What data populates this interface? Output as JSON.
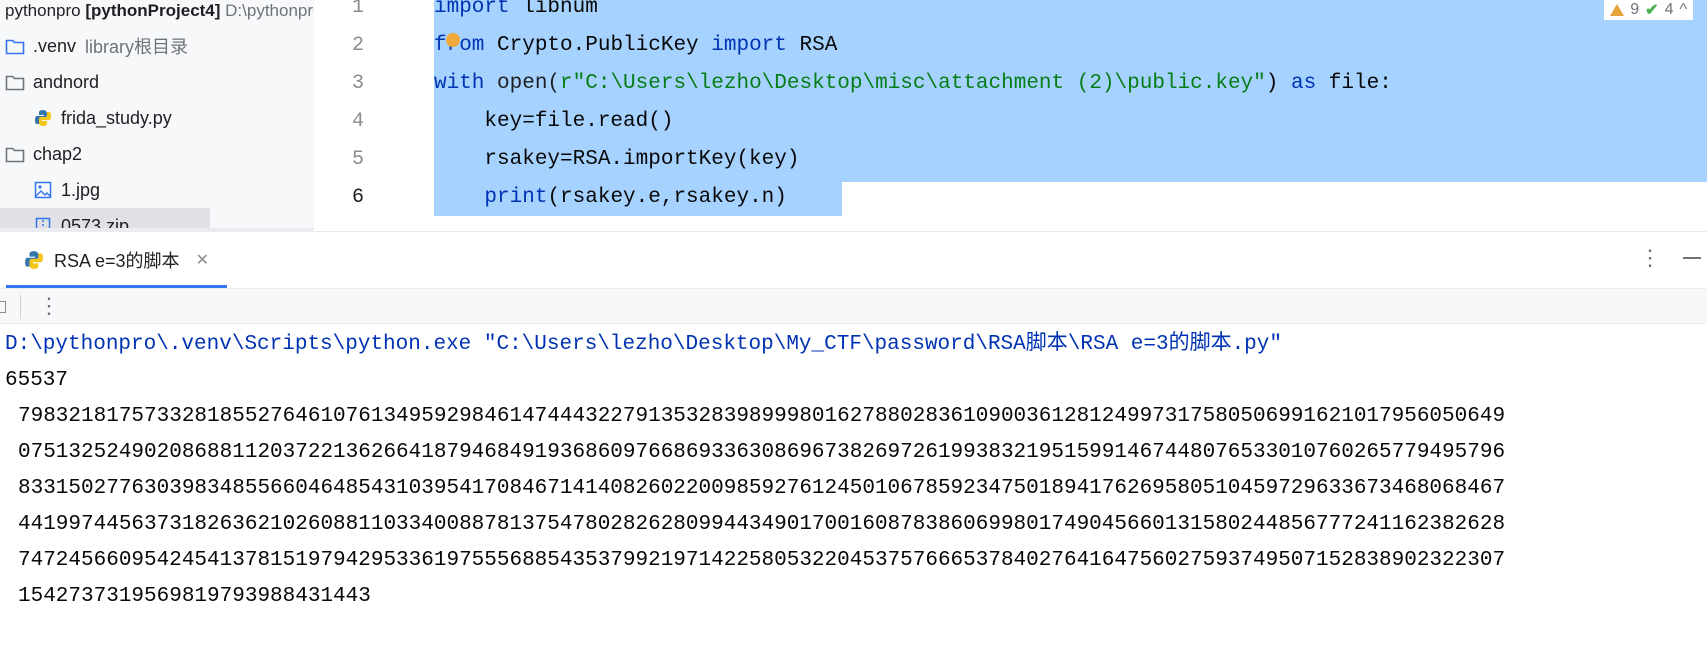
{
  "project": {
    "root": {
      "name": "pythonpro",
      "project": "[pythonProject4]",
      "path": "D:\\pythonpro"
    },
    "items": [
      {
        "label": ".venv",
        "hint": "library根目录",
        "icon": "folder-icon"
      },
      {
        "label": "andnord",
        "icon": "folder-icon"
      },
      {
        "label": "frida_study.py",
        "icon": "python-file-icon"
      },
      {
        "label": "chap2",
        "icon": "folder-icon"
      },
      {
        "label": "1.jpg",
        "icon": "image-file-icon"
      },
      {
        "label": "0573.zip",
        "icon": "zip-file-icon"
      }
    ]
  },
  "editor": {
    "line_numbers": [
      "1",
      "2",
      "3",
      "4",
      "5",
      "6"
    ],
    "lines": [
      {
        "kw1": "import",
        "rest": " libnum"
      },
      {
        "kw1": "from",
        "mid": " Crypto.PublicKey ",
        "kw2": "import",
        "rest": " RSA"
      },
      {
        "kw1": "with",
        "fn": " open(",
        "str": "r\"C:\\Users\\lezho\\Desktop\\misc\\attachment (2)\\public.key\"",
        "mid": ") ",
        "kw2": "as",
        "rest": " file:"
      },
      {
        "text": "    key=file.read()"
      },
      {
        "text": "    rsakey=RSA.importKey(key)"
      },
      {
        "indent": "    ",
        "kw1": "print",
        "rest": "(rsakey.e,rsakey.n)"
      }
    ],
    "inspections": {
      "warnings": "9",
      "weak_warnings": "4"
    }
  },
  "run": {
    "tab_label": "RSA e=3的脚本",
    "console": {
      "command": "D:\\pythonpro\\.venv\\Scripts\\python.exe \"C:\\Users\\lezho\\Desktop\\My_CTF\\password\\RSA脚本\\RSA e=3的脚本.py\"",
      "e_value": "65537",
      "n_lines": [
        "7983218175733281855276461076134959298461474443227913532839899980162788028361090036128124997317580506991621017956050649",
        "0751325249020868811203722136266418794684919368609766869336308696738269726199383219515991467448076533010760265779495796",
        "8331502776303983485566046485431039541708467141408260220098592761245010678592347501894176269580510459729633673468068467",
        "4419974456373182636210260881103340088781375478028262809944349017001608783860699801749045660131580244856777241162382628",
        "7472456609542454137815197942953361975556885435379921971422580532204537576665378402764164756027593749507152838902322307",
        "154273731956981979398843144​3"
      ]
    }
  }
}
